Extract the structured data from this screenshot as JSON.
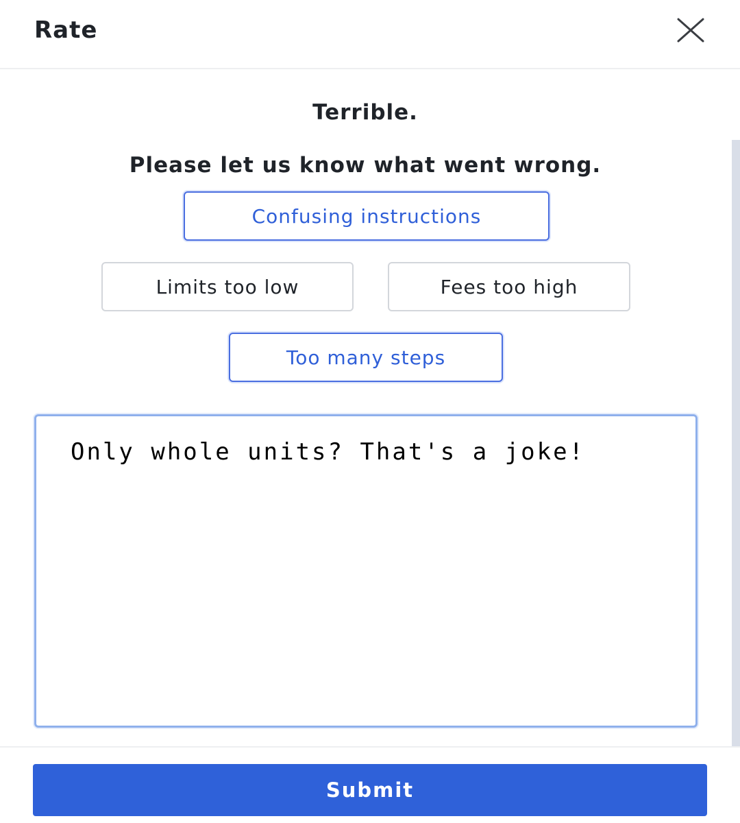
{
  "header": {
    "title": "Rate",
    "close_icon": "close-icon"
  },
  "rating": {
    "label": "Terrible."
  },
  "prompt": {
    "text": "Please let us know what went wrong."
  },
  "reasons": [
    {
      "label": "Confusing instructions",
      "selected": true
    },
    {
      "label": "Limits too low",
      "selected": false
    },
    {
      "label": "Fees too high",
      "selected": false
    },
    {
      "label": "Too many steps",
      "selected": true
    }
  ],
  "feedback": {
    "value": "Only whole units? That's a joke!"
  },
  "footer": {
    "submit_label": "Submit"
  },
  "colors": {
    "accent": "#2f61d9",
    "selected_border": "#4a6ee0",
    "unselected_border": "#d3d6db",
    "focus_border": "#8fb0ec"
  }
}
